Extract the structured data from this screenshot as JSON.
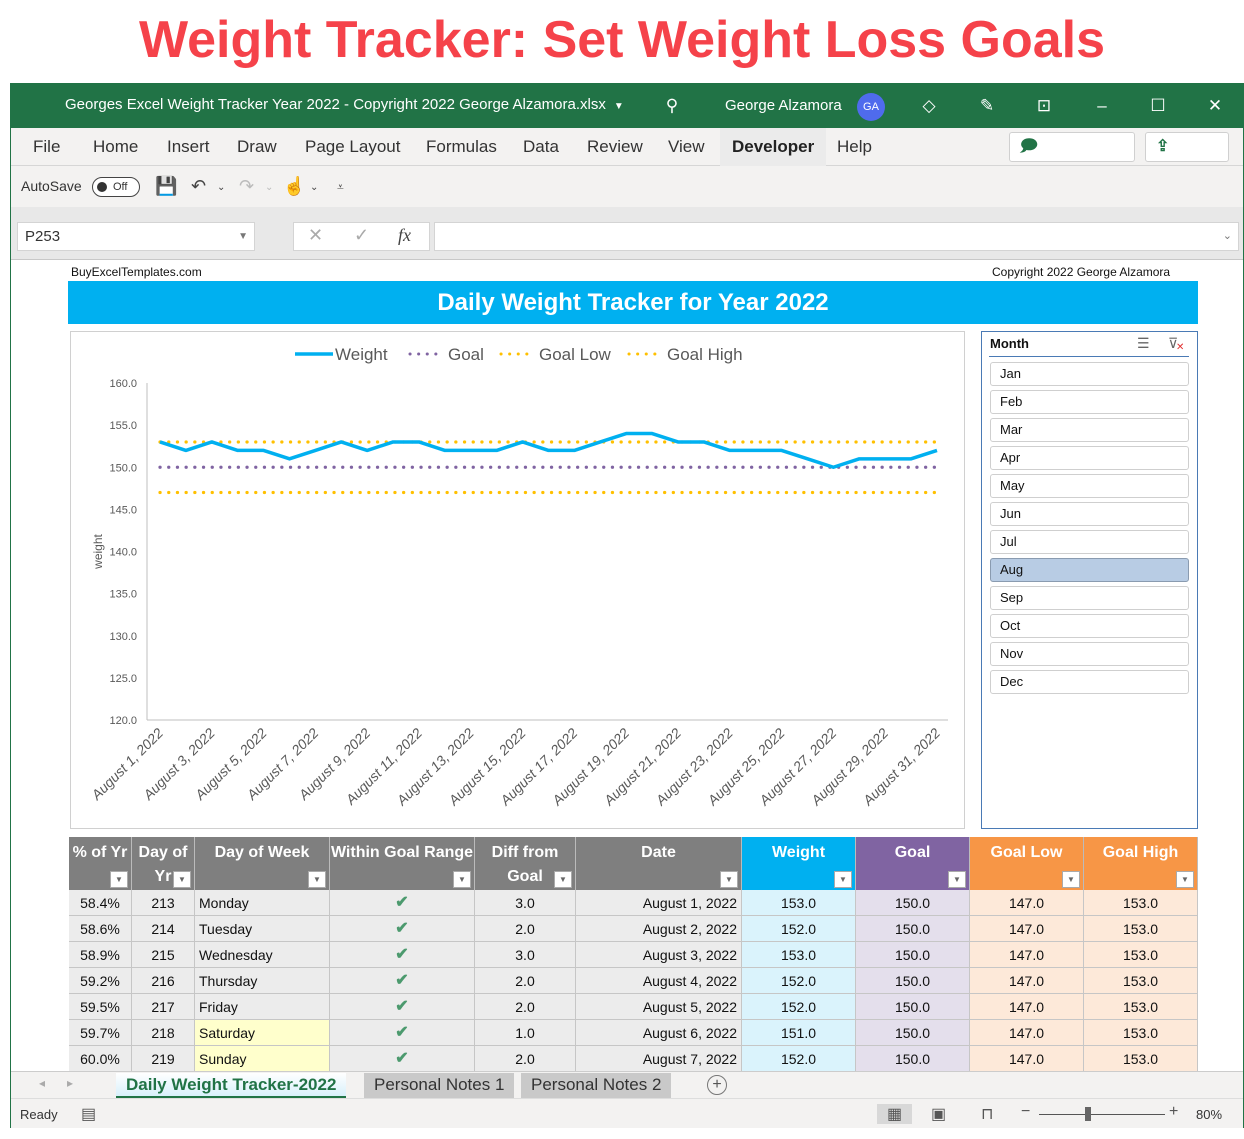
{
  "banner": "Weight Tracker: Set Weight Loss Goals",
  "window": {
    "title": "Georges Excel Weight Tracker Year 2022 - Copyright 2022 George Alzamora.xlsx",
    "user_name": "George Alzamora",
    "user_initials": "GA"
  },
  "menu": {
    "items": [
      "File",
      "Home",
      "Insert",
      "Draw",
      "Page Layout",
      "Formulas",
      "Data",
      "Review",
      "View",
      "Developer",
      "Help"
    ],
    "active": "Developer",
    "comments_label": "Comments",
    "share_label": "Share"
  },
  "qat": {
    "autosave_label": "AutoSave",
    "autosave_state": "Off"
  },
  "formula_bar": {
    "name_box": "P253",
    "formula": ""
  },
  "sheet": {
    "site": "BuyExcelTemplates.com",
    "copyright": "Copyright 2022  George Alzamora",
    "title": "Daily Weight Tracker for Year 2022"
  },
  "slicer": {
    "header": "Month",
    "items": [
      "Jan",
      "Feb",
      "Mar",
      "Apr",
      "May",
      "Jun",
      "Jul",
      "Aug",
      "Sep",
      "Oct",
      "Nov",
      "Dec"
    ],
    "selected": "Aug"
  },
  "chart_data": {
    "type": "line",
    "title": "",
    "xlabel": "",
    "ylabel": "weight",
    "ylim": [
      120,
      160
    ],
    "yticks": [
      "160.0",
      "155.0",
      "150.0",
      "145.0",
      "140.0",
      "135.0",
      "130.0",
      "125.0",
      "120.0"
    ],
    "legend_position": "top",
    "x_tick_labels": [
      "August 1, 2022",
      "August 3, 2022",
      "August 5, 2022",
      "August 7, 2022",
      "August 9, 2022",
      "August 11, 2022",
      "August 13, 2022",
      "August 15, 2022",
      "August 17, 2022",
      "August 19, 2022",
      "August 21, 2022",
      "August 23, 2022",
      "August 25, 2022",
      "August 27, 2022",
      "August 29, 2022",
      "August 31, 2022"
    ],
    "x": [
      1,
      2,
      3,
      4,
      5,
      6,
      7,
      8,
      9,
      10,
      11,
      12,
      13,
      14,
      15,
      16,
      17,
      18,
      19,
      20,
      21,
      22,
      23,
      24,
      25,
      26,
      27,
      28,
      29,
      30,
      31
    ],
    "series": [
      {
        "name": "Weight",
        "color": "#00b0f0",
        "style": "solid",
        "values": [
          153,
          152,
          153,
          152,
          152,
          151,
          152,
          153,
          152,
          153,
          153,
          152,
          152,
          152,
          153,
          152,
          152,
          153,
          154,
          154,
          153,
          153,
          152,
          152,
          152,
          151,
          150,
          151,
          151,
          151,
          152
        ]
      },
      {
        "name": "Goal",
        "color": "#8064a2",
        "style": "dotted",
        "values": [
          150,
          150,
          150,
          150,
          150,
          150,
          150,
          150,
          150,
          150,
          150,
          150,
          150,
          150,
          150,
          150,
          150,
          150,
          150,
          150,
          150,
          150,
          150,
          150,
          150,
          150,
          150,
          150,
          150,
          150,
          150
        ]
      },
      {
        "name": "Goal Low",
        "color": "#ffc000",
        "style": "dotted",
        "values": [
          147,
          147,
          147,
          147,
          147,
          147,
          147,
          147,
          147,
          147,
          147,
          147,
          147,
          147,
          147,
          147,
          147,
          147,
          147,
          147,
          147,
          147,
          147,
          147,
          147,
          147,
          147,
          147,
          147,
          147,
          147
        ]
      },
      {
        "name": "Goal High",
        "color": "#ffc000",
        "style": "dotted",
        "values": [
          153,
          153,
          153,
          153,
          153,
          153,
          153,
          153,
          153,
          153,
          153,
          153,
          153,
          153,
          153,
          153,
          153,
          153,
          153,
          153,
          153,
          153,
          153,
          153,
          153,
          153,
          153,
          153,
          153,
          153,
          153
        ]
      }
    ]
  },
  "table": {
    "headers": [
      {
        "label": "% of Yr",
        "color": "#7f7f7f"
      },
      {
        "label": "Day of Yr",
        "color": "#7f7f7f"
      },
      {
        "label": "Day of Week",
        "color": "#7f7f7f"
      },
      {
        "label": "Within Goal Range",
        "color": "#7f7f7f"
      },
      {
        "label": "Diff from Goal",
        "color": "#7f7f7f"
      },
      {
        "label": "Date",
        "color": "#7f7f7f"
      },
      {
        "label": "Weight",
        "color": "#00b0f0"
      },
      {
        "label": "Goal",
        "color": "#8064a2"
      },
      {
        "label": "Goal Low",
        "color": "#f79646"
      },
      {
        "label": "Goal High",
        "color": "#f79646"
      }
    ],
    "rows": [
      [
        "58.4%",
        "213",
        "Monday",
        "✔",
        "3.0",
        "August 1, 2022",
        "153.0",
        "150.0",
        "147.0",
        "153.0"
      ],
      [
        "58.6%",
        "214",
        "Tuesday",
        "✔",
        "2.0",
        "August 2, 2022",
        "152.0",
        "150.0",
        "147.0",
        "153.0"
      ],
      [
        "58.9%",
        "215",
        "Wednesday",
        "✔",
        "3.0",
        "August 3, 2022",
        "153.0",
        "150.0",
        "147.0",
        "153.0"
      ],
      [
        "59.2%",
        "216",
        "Thursday",
        "✔",
        "2.0",
        "August 4, 2022",
        "152.0",
        "150.0",
        "147.0",
        "153.0"
      ],
      [
        "59.5%",
        "217",
        "Friday",
        "✔",
        "2.0",
        "August 5, 2022",
        "152.0",
        "150.0",
        "147.0",
        "153.0"
      ],
      [
        "59.7%",
        "218",
        "Saturday",
        "✔",
        "1.0",
        "August 6, 2022",
        "151.0",
        "150.0",
        "147.0",
        "153.0"
      ],
      [
        "60.0%",
        "219",
        "Sunday",
        "✔",
        "2.0",
        "August 7, 2022",
        "152.0",
        "150.0",
        "147.0",
        "153.0"
      ]
    ],
    "weekend_color": "#ffffcc",
    "col_fills": [
      "#ececec",
      "#ececec",
      "#ececec",
      "#ececec",
      "#ececec",
      "#ececec",
      "#daf3fc",
      "#e4dfec",
      "#fde9d9",
      "#fde9d9"
    ]
  },
  "tabs": {
    "sheets": [
      "Daily Weight Tracker-2022",
      "Personal Notes 1",
      "Personal Notes 2"
    ],
    "active": "Daily Weight Tracker-2022"
  },
  "status": {
    "ready": "Ready",
    "zoom": "80%",
    "zoom_level": 0.8
  }
}
